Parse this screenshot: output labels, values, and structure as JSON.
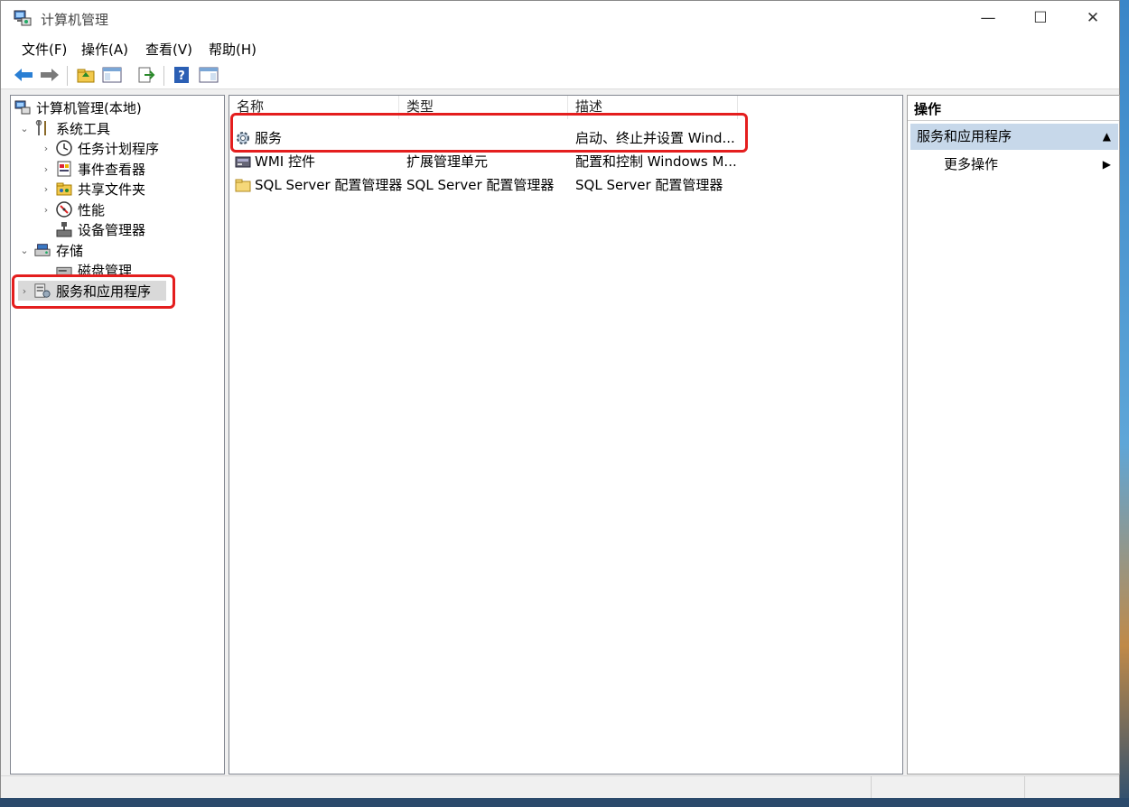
{
  "window": {
    "title": "计算机管理"
  },
  "menu": [
    {
      "label": "文件(F)"
    },
    {
      "label": "操作(A)"
    },
    {
      "label": "查看(V)"
    },
    {
      "label": "帮助(H)"
    }
  ],
  "window_controls": {
    "minimize": "—",
    "maximize": "☐",
    "close": "✕"
  },
  "toolbar": [
    "back-icon",
    "forward-icon",
    "up-folder-icon",
    "show-hide-tree-icon",
    "export-list-icon",
    "help-icon",
    "show-hide-action-pane-icon"
  ],
  "tree": {
    "root": "计算机管理(本地)",
    "system_tools": "系统工具",
    "task_scheduler": "任务计划程序",
    "event_viewer": "事件查看器",
    "shared_folders": "共享文件夹",
    "performance": "性能",
    "device_manager": "设备管理器",
    "storage": "存储",
    "disk_management": "磁盘管理",
    "services_apps": "服务和应用程序",
    "expanded_arrow": "⌄",
    "collapsed_arrow": "›"
  },
  "columns": {
    "name": "名称",
    "type": "类型",
    "desc": "描述"
  },
  "rows": [
    {
      "name": "服务",
      "type": "",
      "desc": "启动、终止并设置 Wind..."
    },
    {
      "name": "WMI 控件",
      "type": "扩展管理单元",
      "desc": "配置和控制 Windows M..."
    },
    {
      "name": "SQL Server 配置管理器",
      "type": "SQL Server 配置管理器",
      "desc": "SQL Server 配置管理器"
    }
  ],
  "actions": {
    "header": "操作",
    "group": "服务和应用程序",
    "group_caret": "▲",
    "more": "更多操作",
    "more_caret": "▶"
  },
  "colors": {
    "selection_highlight": "#e41e1e",
    "action_group_bg": "#c7d8ea"
  }
}
